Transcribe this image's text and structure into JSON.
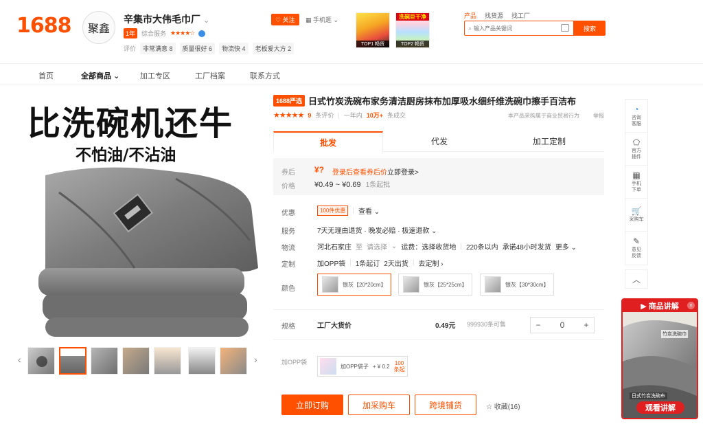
{
  "header": {
    "logo": "1688",
    "shop_avatar_text": "聚鑫",
    "shop_name": "辛集市大伟毛巾厂",
    "shop_chevron": "⌄",
    "year_badge": "1年",
    "service_label": "综合服务",
    "stars": "★★★★☆",
    "scores": [
      {
        "label": "评价",
        "value": ""
      },
      {
        "label": "",
        "value": "非常满意 8"
      },
      {
        "label": "",
        "value": "质量很好 6"
      },
      {
        "label": "",
        "value": "物流快 4"
      },
      {
        "label": "",
        "value": "老板爱大方 2"
      }
    ],
    "follow_label": "关注",
    "mobile_label": "手机逛",
    "promos": [
      {
        "title": "",
        "rank": "TOP1 畅货"
      },
      {
        "title": "洗碗巨干净",
        "rank": "TOP2 畅货"
      }
    ],
    "search_tabs": [
      "产品",
      "找货源",
      "找工厂"
    ],
    "search_placeholder": "输入产品关键词",
    "search_button": "搜索"
  },
  "nav": {
    "items": [
      "首页",
      "全部商品",
      "加工专区",
      "工厂档案",
      "联系方式"
    ]
  },
  "gallery": {
    "hero_text": "比洗碗机还牛",
    "hero_sub": "不怕油/不沾油",
    "prev": "‹",
    "next": "›",
    "thumb_count": 7
  },
  "product": {
    "tag": "1688严选",
    "title": "日式竹炭洗碗布家务清洁厨房抹布加厚吸水细纤维洗碗巾擦手百洁布",
    "stars": "★★★★★",
    "rating": "4.6",
    "review_count": "9",
    "review_label": "条评价",
    "sold_prefix": "一年内",
    "sold_count": "10万+",
    "sold_suffix": "条成交",
    "note_right": "本产品采购属于商业贸易行为",
    "report": "举报",
    "tabs": [
      "批发",
      "代发",
      "加工定制"
    ],
    "coupon_label": "券后",
    "coupon_price": "¥?",
    "coupon_link": "登录后查看券后价",
    "coupon_login": "立即登录>",
    "price_label": "价格",
    "price_low": "¥0.49",
    "price_sep": "~",
    "price_high": "¥0.69",
    "price_unit": "1条起批",
    "rows": {
      "discount_label": "优惠",
      "discount_tag": "100件优惠",
      "discount_view": "查看 ⌄",
      "service_label": "服务",
      "service_value": "7天无理由退货 · 晚发必赔 · 极速退款 ⌄",
      "logistics_label": "物流",
      "logistics_from": "河北石家庄",
      "logistics_to_label": "至",
      "logistics_to": "请选择",
      "logistics_fee": "运费：选择收货地",
      "logistics_qty": "220条以内",
      "logistics_ship": "承诺48小时发货",
      "logistics_more": "更多 ⌄",
      "custom_label": "定制",
      "custom_opp": "加OPP袋",
      "custom_min": "1条起订",
      "custom_days": "2天出货",
      "custom_go": "去定制 ›",
      "color_label": "颜色",
      "colors": [
        "银灰【20*20cm】",
        "银灰【25*25cm】",
        "银灰【30*30cm】"
      ],
      "spec_label": "规格",
      "spec_name": "工厂大货价",
      "spec_price": "0.49元",
      "spec_stock": "999930条可售",
      "qty_minus": "−",
      "qty_value": "0",
      "qty_plus": "+",
      "opp_label": "加OPP袋",
      "opp_name": "加OPP袋子",
      "opp_price": "+ ¥ 0.2",
      "opp_min_1": "100",
      "opp_min_2": "条起"
    },
    "buttons": {
      "buy": "立即订购",
      "cart": "加采购车",
      "cross": "跨境铺货",
      "fav": "☆ 收藏(16)"
    }
  },
  "sidebar": {
    "items": [
      {
        "icon": "◔",
        "label_1": "咨询",
        "label_2": "客服"
      },
      {
        "icon": "⬠",
        "label_1": "官方",
        "label_2": "插件"
      },
      {
        "icon": "▦",
        "label_1": "手机",
        "label_2": "下单"
      },
      {
        "icon": "🛒",
        "label_1": "采购车",
        "label_2": ""
      },
      {
        "icon": "✎",
        "label_1": "意见",
        "label_2": "反馈"
      }
    ],
    "up": "︿"
  },
  "live": {
    "title": "商品讲解",
    "close": "×",
    "label": "竹炭洗碗巾",
    "caption": "日式竹炭洗碗布",
    "button": "观看讲解"
  },
  "colors": {
    "accent": "#ff5000",
    "live_red": "#e02020"
  }
}
